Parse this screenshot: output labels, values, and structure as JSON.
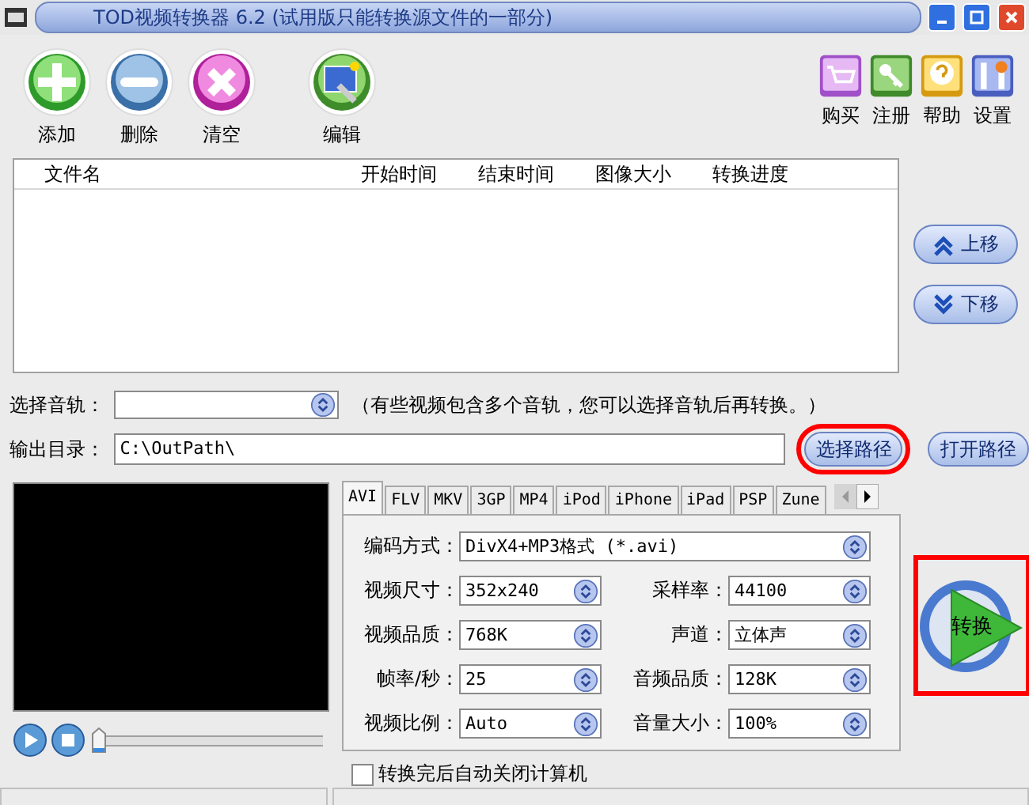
{
  "window": {
    "title": "TOD视频转换器 6.2 (试用版只能转换源文件的一部分)"
  },
  "toolbar_left": [
    {
      "label": "添加",
      "kind": "add"
    },
    {
      "label": "删除",
      "kind": "remove"
    },
    {
      "label": "清空",
      "kind": "clear"
    },
    {
      "label": "编辑",
      "kind": "edit"
    }
  ],
  "toolbar_right": [
    {
      "label": "购买",
      "kind": "cart"
    },
    {
      "label": "注册",
      "kind": "key"
    },
    {
      "label": "帮助",
      "kind": "help"
    },
    {
      "label": "设置",
      "kind": "tools"
    }
  ],
  "file_list": {
    "columns": [
      "文件名",
      "开始时间",
      "结束时间",
      "图像大小",
      "转换进度"
    ]
  },
  "side_buttons": [
    {
      "label": "上移",
      "kind": "up"
    },
    {
      "label": "下移",
      "kind": "down"
    }
  ],
  "audio_track": {
    "label": "选择音轨：",
    "hint": "（有些视频包含多个音轨，您可以选择音轨后再转换。）"
  },
  "output": {
    "label": "输出目录：",
    "value": "C:\\OutPath\\",
    "browse": {
      "label": "选择路径",
      "highlighted": true
    },
    "open": {
      "label": "打开路径",
      "highlighted": false
    }
  },
  "player": {
    "level": 0
  },
  "format_tabs": [
    {
      "label": "AVI",
      "selected": true
    },
    {
      "label": "FLV",
      "selected": false
    },
    {
      "label": "MKV",
      "selected": false
    },
    {
      "label": "3GP",
      "selected": false
    },
    {
      "label": "MP4",
      "selected": false
    },
    {
      "label": "iPod",
      "selected": false
    },
    {
      "label": "iPhone",
      "selected": false
    },
    {
      "label": "iPad",
      "selected": false
    },
    {
      "label": "PSP",
      "selected": false
    },
    {
      "label": "Zune",
      "selected": false
    }
  ],
  "encoding": {
    "label": "编码方式：",
    "value": "DivX4+MP3格式 (*.avi)"
  },
  "settings": [
    {
      "left": {
        "label": "视频尺寸：",
        "value": "352x240"
      },
      "right": {
        "label": "采样率：",
        "value": "44100"
      }
    },
    {
      "left": {
        "label": "视频品质：",
        "value": "768K"
      },
      "right": {
        "label": "声道：",
        "value": "立体声"
      }
    },
    {
      "left": {
        "label": "帧率/秒：",
        "value": "25"
      },
      "right": {
        "label": "音频品质：",
        "value": "128K"
      }
    },
    {
      "left": {
        "label": "视频比例：",
        "value": "Auto"
      },
      "right": {
        "label": "音量大小：",
        "value": "100%"
      }
    }
  ],
  "shutdown_checkbox": {
    "label": "转换完后自动关闭计算机",
    "checked": false
  },
  "convert_button": {
    "label": "转换",
    "highlighted": true
  }
}
